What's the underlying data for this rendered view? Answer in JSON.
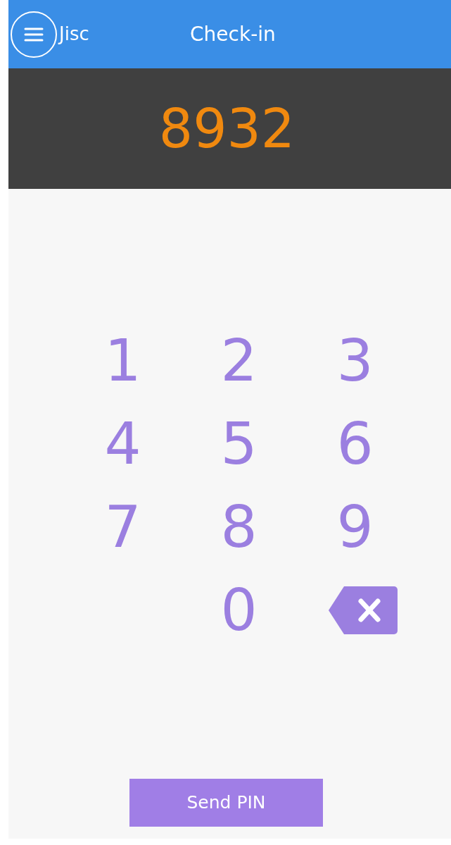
{
  "header": {
    "brand": "Jisc",
    "title": "Check-in"
  },
  "pin_display": "8932",
  "keypad": [
    {
      "kind": "digit",
      "label": "1"
    },
    {
      "kind": "digit",
      "label": "2"
    },
    {
      "kind": "digit",
      "label": "3"
    },
    {
      "kind": "digit",
      "label": "4"
    },
    {
      "kind": "digit",
      "label": "5"
    },
    {
      "kind": "digit",
      "label": "6"
    },
    {
      "kind": "digit",
      "label": "7"
    },
    {
      "kind": "digit",
      "label": "8"
    },
    {
      "kind": "digit",
      "label": "9"
    },
    {
      "kind": "empty"
    },
    {
      "kind": "digit",
      "label": "0"
    },
    {
      "kind": "backspace"
    }
  ],
  "button": "Send PIN"
}
